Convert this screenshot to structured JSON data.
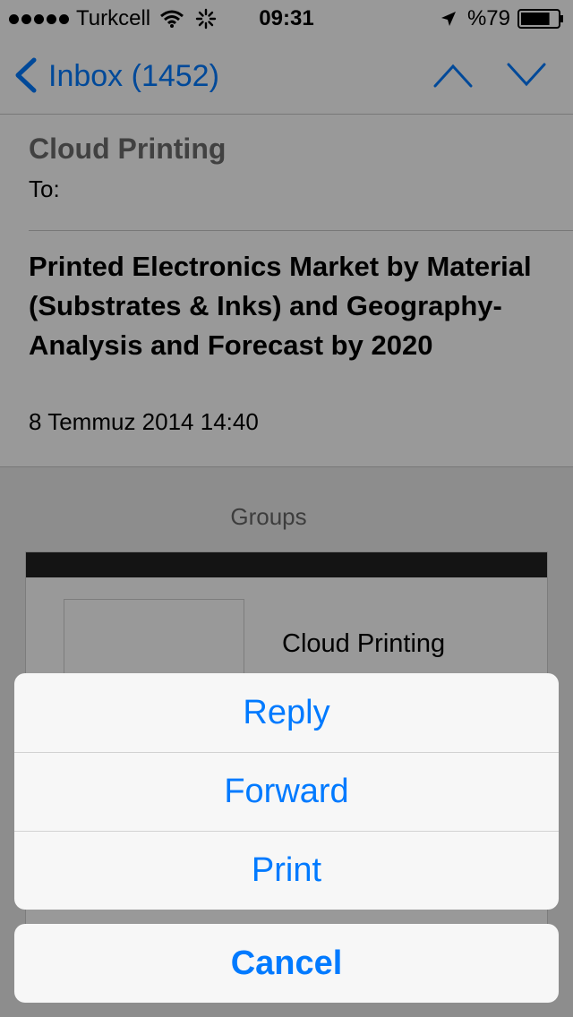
{
  "status_bar": {
    "carrier": "Turkcell",
    "time": "09:31",
    "battery_percent": "%79",
    "battery_level": 0.79,
    "icons": [
      "signal-dots-icon",
      "wifi-icon",
      "activity-spinner-icon",
      "location-arrow-icon",
      "battery-icon"
    ]
  },
  "nav": {
    "back_label": "Inbox (1452)",
    "icons": [
      "back-chevron-icon",
      "previous-message-icon",
      "next-message-icon"
    ]
  },
  "email": {
    "sender": "Cloud Printing",
    "to_label": "To:",
    "subject": "Printed Electronics Market by Material (Substrates & Inks) and Geography- Analysis and Forecast by 2020",
    "date": "8 Temmuz 2014 14:40",
    "body": {
      "groups_label": "Groups",
      "card_title": "Cloud Printing"
    }
  },
  "action_sheet": {
    "items": [
      {
        "label": "Reply"
      },
      {
        "label": "Forward"
      },
      {
        "label": "Print"
      }
    ],
    "cancel_label": "Cancel"
  },
  "colors": {
    "accent": "#007aff",
    "dim_overlay": "rgba(0,0,0,0.4)",
    "sheet_background": "#f7f7f7"
  }
}
